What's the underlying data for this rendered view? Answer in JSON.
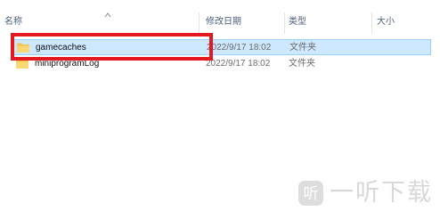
{
  "columns": {
    "name": "名称",
    "date": "修改日期",
    "type": "类型",
    "size": "大小"
  },
  "rows": [
    {
      "name": "gamecaches",
      "date": "2022/9/17 18:02",
      "type": "文件夹",
      "selected": true
    },
    {
      "name": "miniprogramLog",
      "date": "2022/9/17 18:02",
      "type": "文件夹",
      "selected": false
    }
  ],
  "watermark": {
    "text": "一听下载"
  },
  "icons": {
    "folder": "folder-icon",
    "sort": "sort-up-icon",
    "watermark_logo": "yiting-logo"
  },
  "colors": {
    "selection": "#cde8ff",
    "selection_border": "#99d1ff",
    "highlight": "#e4191f",
    "folder": "#f3c44b"
  }
}
